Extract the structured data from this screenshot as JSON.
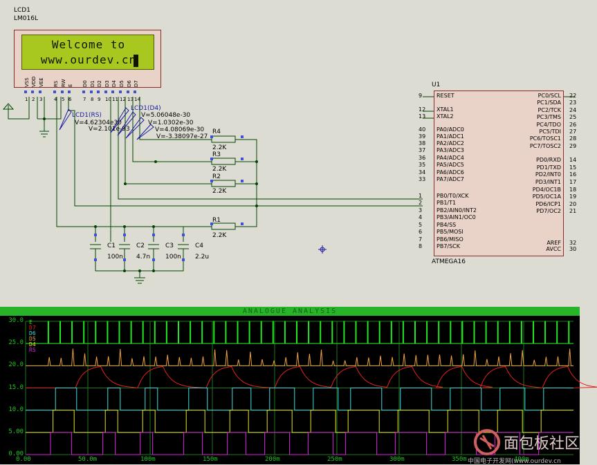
{
  "lcd": {
    "ref": "LCD1",
    "model": "LM016L",
    "line1": "Welcome to",
    "line2": "www.ourdev.cn",
    "pin_labels": [
      "VSS",
      "VDD",
      "VEE",
      "RS",
      "RW",
      "E",
      "D0",
      "D1",
      "D2",
      "D3",
      "D4",
      "D5",
      "D6",
      "D7"
    ],
    "pin_numbers": [
      "1",
      "2",
      "3",
      "4",
      "5",
      "6",
      "7",
      "8",
      "9",
      "10",
      "11",
      "12",
      "13",
      "14"
    ]
  },
  "probes": {
    "rs_name": "LCD1(RS)",
    "rs_value_a": "V=4.62304e30",
    "rs_value_b": "V=2.101e-93",
    "d4_name": "LCD1(D4)",
    "d4_value_a": "V=5.06048e-30",
    "d4_value_b": "V=1.0302e-30",
    "d4_value_c": "V=4.08069e-30",
    "d4_value_d": "V=-3.38097e-27"
  },
  "resistors": [
    {
      "ref": "R4",
      "value": "2.2K"
    },
    {
      "ref": "R3",
      "value": "2.2K"
    },
    {
      "ref": "R2",
      "value": "2.2K"
    },
    {
      "ref": "R1",
      "value": "2.2K"
    }
  ],
  "capacitors": [
    {
      "ref": "C1",
      "value": "100n"
    },
    {
      "ref": "C2",
      "value": "4.7n"
    },
    {
      "ref": "C3",
      "value": "100n"
    },
    {
      "ref": "C4",
      "value": "2.2u"
    }
  ],
  "mcu": {
    "ref": "U1",
    "model": "ATMEGA16",
    "left_pins": [
      {
        "num": "9",
        "name": "RESET"
      },
      {
        "num": "12",
        "name": "XTAL1"
      },
      {
        "num": "13",
        "name": "XTAL2"
      },
      {
        "num": "40",
        "name": "PA0/ADC0"
      },
      {
        "num": "39",
        "name": "PA1/ADC1"
      },
      {
        "num": "38",
        "name": "PA2/ADC2"
      },
      {
        "num": "37",
        "name": "PA3/ADC3"
      },
      {
        "num": "36",
        "name": "PA4/ADC4"
      },
      {
        "num": "35",
        "name": "PA5/ADC5"
      },
      {
        "num": "34",
        "name": "PA6/ADC6"
      },
      {
        "num": "33",
        "name": "PA7/ADC7"
      },
      {
        "num": "1",
        "name": "PB0/T0/XCK"
      },
      {
        "num": "2",
        "name": "PB1/T1"
      },
      {
        "num": "3",
        "name": "PB2/AIN0/INT2"
      },
      {
        "num": "4",
        "name": "PB3/AIN1/OC0"
      },
      {
        "num": "5",
        "name": "PB4/SS"
      },
      {
        "num": "6",
        "name": "PB5/MOSI"
      },
      {
        "num": "7",
        "name": "PB6/MISO"
      },
      {
        "num": "8",
        "name": "PB7/SCK"
      }
    ],
    "right_pins": [
      {
        "num": "22",
        "name": "PC0/SCL"
      },
      {
        "num": "23",
        "name": "PC1/SDA"
      },
      {
        "num": "24",
        "name": "PC2/TCK"
      },
      {
        "num": "25",
        "name": "PC3/TMS"
      },
      {
        "num": "26",
        "name": "PC4/TDO"
      },
      {
        "num": "27",
        "name": "PC5/TDI"
      },
      {
        "num": "28",
        "name": "PC6/TOSC1"
      },
      {
        "num": "29",
        "name": "PC7/TOSC2"
      },
      {
        "num": "14",
        "name": "PD0/RXD"
      },
      {
        "num": "15",
        "name": "PD1/TXD"
      },
      {
        "num": "16",
        "name": "PD2/INT0"
      },
      {
        "num": "17",
        "name": "PD3/INT1"
      },
      {
        "num": "18",
        "name": "PD4/OC1B"
      },
      {
        "num": "19",
        "name": "PD5/OC1A"
      },
      {
        "num": "20",
        "name": "PD6/ICP1"
      },
      {
        "num": "21",
        "name": "PD7/OC2"
      },
      {
        "num": "32",
        "name": "AREF"
      },
      {
        "num": "30",
        "name": "AVCC"
      }
    ]
  },
  "graph": {
    "title": "ANALOGUE ANALYSIS",
    "watermark": "面包板社区",
    "footer_text": "中国电子开发网(www.ourdev.cn",
    "colors": {
      "bg": "#000000",
      "grid": "#1e7a1e",
      "axis_text": "#22c822"
    }
  },
  "chart_data": {
    "type": "line",
    "title": "ANALOGUE ANALYSIS",
    "xlabel": "",
    "ylabel": "",
    "x_ticks": [
      "0.00",
      "50.0m",
      "100m",
      "150m",
      "200m",
      "250m",
      "300m",
      "350m",
      "400m"
    ],
    "y_ticks": [
      "30.0",
      "25.0",
      "20.0",
      "15.0",
      "10.0",
      "5.00",
      "0.00"
    ],
    "xlim": [
      0,
      0.44
    ],
    "ylim": [
      0,
      30
    ],
    "grid": true,
    "legend_placement": "top-left",
    "series": [
      {
        "name": "E",
        "color": "#22e822",
        "kind": "pulses",
        "baseline": 25,
        "high": 30
      },
      {
        "name": "D7",
        "color": "#e82020",
        "kind": "rc",
        "low": 15,
        "high": 20
      },
      {
        "name": "D6",
        "color": "#40e0e0",
        "kind": "square",
        "low": 10,
        "high": 15
      },
      {
        "name": "D5",
        "color": "#f0a040",
        "kind": "spikes",
        "baseline": 20,
        "high": 25
      },
      {
        "name": "D4",
        "color": "#e8e820",
        "kind": "square",
        "low": 5,
        "high": 10
      },
      {
        "name": "RS",
        "color": "#e020e0",
        "kind": "square",
        "low": 0,
        "high": 5
      }
    ]
  }
}
